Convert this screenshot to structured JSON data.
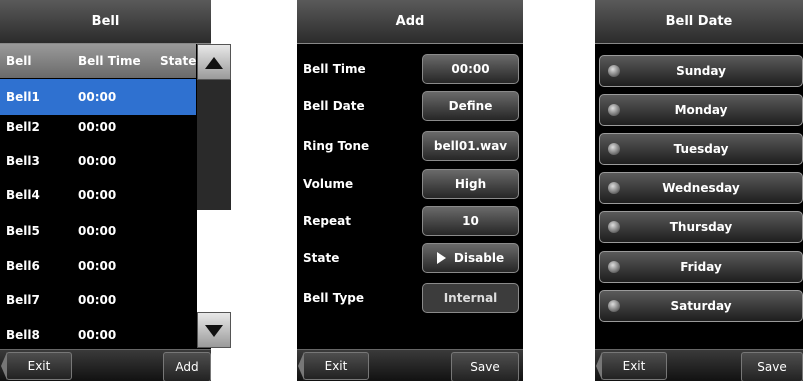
{
  "bell_list": {
    "title": "Bell",
    "columns": [
      "Bell",
      "Bell Time",
      "State"
    ],
    "rows": [
      {
        "bell": "Bell1",
        "time": "00:00"
      },
      {
        "bell": "Bell2",
        "time": "00:00"
      },
      {
        "bell": "Bell3",
        "time": "00:00"
      },
      {
        "bell": "Bell4",
        "time": "00:00"
      },
      {
        "bell": "Bell5",
        "time": "00:00"
      },
      {
        "bell": "Bell6",
        "time": "00:00"
      },
      {
        "bell": "Bell7",
        "time": "00:00"
      },
      {
        "bell": "Bell8",
        "time": "00:00"
      }
    ],
    "exit_label": "Exit",
    "add_label": "Add"
  },
  "add_form": {
    "title": "Add",
    "fields": [
      {
        "label": "Bell Time",
        "value": "00:00"
      },
      {
        "label": "Bell Date",
        "value": "Define"
      },
      {
        "label": "Ring Tone",
        "value": "bell01.wav"
      },
      {
        "label": "Volume",
        "value": "High"
      },
      {
        "label": "Repeat",
        "value": "10"
      },
      {
        "label": "State",
        "value": "Disable"
      },
      {
        "label": "Bell Type",
        "value": "Internal"
      }
    ],
    "exit_label": "Exit",
    "save_label": "Save"
  },
  "bell_date": {
    "title": "Bell Date",
    "days": [
      "Sunday",
      "Monday",
      "Tuesday",
      "Wednesday",
      "Thursday",
      "Friday",
      "Saturday"
    ],
    "exit_label": "Exit",
    "save_label": "Save"
  },
  "colors": {
    "selected_row": "#2f71d0",
    "background": "#000000"
  }
}
